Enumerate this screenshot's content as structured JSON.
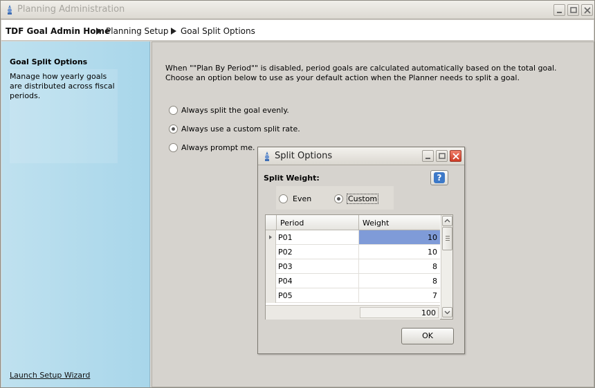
{
  "window": {
    "title": "Planning Administration"
  },
  "breadcrumb": {
    "items": [
      "TDF Goal Admin Home",
      "Planning Setup",
      "Goal Split Options"
    ]
  },
  "sidebar": {
    "title": "Goal Split Options",
    "description": "Manage how yearly goals are distributed across fiscal periods.",
    "link": "Launch Setup Wizard"
  },
  "main": {
    "description": "When \"\"Plan By Period\"\" is disabled, period goals are calculated automatically based on the total goal. Choose an option below to use as your default action when the Planner needs to split a goal.",
    "options": [
      {
        "label": "Always split the goal evenly.",
        "checked": false
      },
      {
        "label": "Always use a custom split rate.",
        "checked": true
      },
      {
        "label": "Always prompt me.",
        "checked": false
      }
    ]
  },
  "dialog": {
    "title": "Split Options",
    "split_weight_label": "Split Weight:",
    "help_label": "?",
    "weight_options": [
      {
        "label": "Even",
        "checked": false
      },
      {
        "label": "Custom",
        "checked": true
      }
    ],
    "grid": {
      "columns": [
        "Period",
        "Weight"
      ],
      "rows": [
        {
          "period": "P01",
          "weight": "10"
        },
        {
          "period": "P02",
          "weight": "10"
        },
        {
          "period": "P03",
          "weight": "8"
        },
        {
          "period": "P04",
          "weight": "8"
        },
        {
          "period": "P05",
          "weight": "7"
        }
      ],
      "total": "100"
    },
    "ok_label": "OK"
  }
}
